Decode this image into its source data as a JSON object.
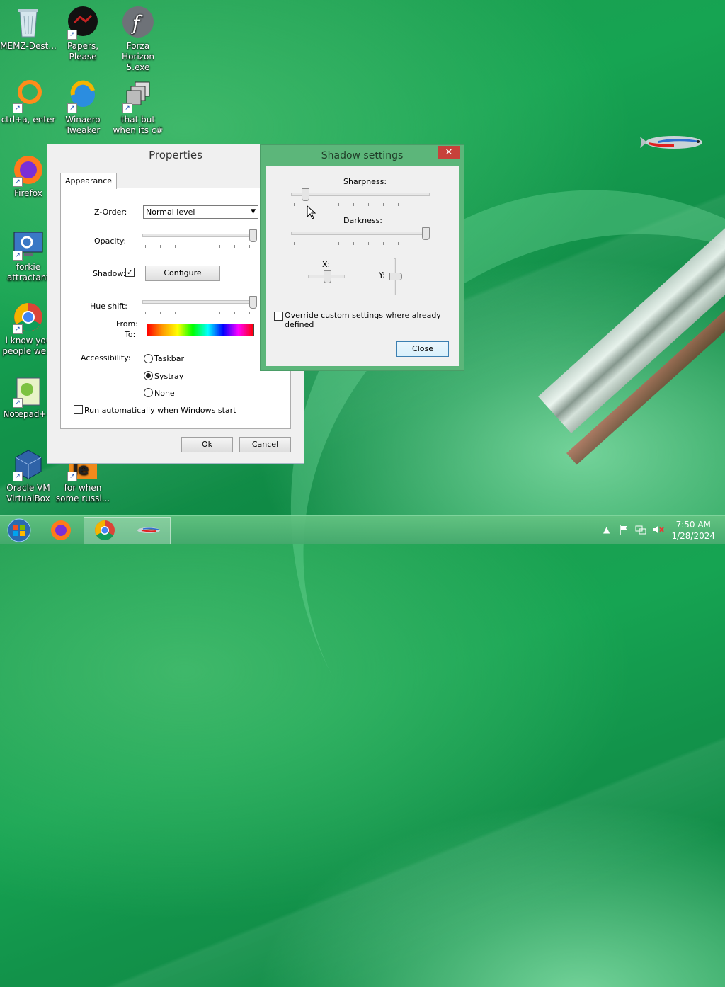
{
  "desktop": {
    "icons": [
      {
        "label": "MEMZ-Dest..."
      },
      {
        "label": "Papers, Please"
      },
      {
        "label": "Forza Horizon 5.exe"
      },
      {
        "label": "ctrl+a, enter"
      },
      {
        "label": "Winaero Tweaker"
      },
      {
        "label": "that but when its c#"
      },
      {
        "label": "Firefox"
      },
      {
        "label": "forkie attractant"
      },
      {
        "label": "i know you people we..."
      },
      {
        "label": "Notepad++"
      },
      {
        "label": "Oracle VM VirtualBox"
      },
      {
        "label": "for when some russi..."
      }
    ]
  },
  "properties": {
    "title": "Properties",
    "tab": "Appearance",
    "zorder_label": "Z-Order:",
    "zorder_value": "Normal level",
    "opacity_label": "Opacity:",
    "opacity_level": 1.0,
    "shadow_label": "Shadow:",
    "shadow_checked": true,
    "configure_label": "Configure",
    "hue_label": "Hue shift:",
    "hue_level": 1.0,
    "from_label": "From:",
    "to_label": "To:",
    "accessibility_label": "Accessibility:",
    "radio_taskbar": "Taskbar",
    "radio_systray": "Systray",
    "radio_none": "None",
    "selected_radio": "Systray",
    "autorun_label": "Run automatically when Windows start",
    "ok_label": "Ok",
    "cancel_label": "Cancel"
  },
  "shadow_settings": {
    "title": "Shadow settings",
    "close_x": "✕",
    "sharpness_label": "Sharpness:",
    "sharpness_level": 0.08,
    "darkness_label": "Darkness:",
    "darkness_level": 1.0,
    "x_label": "X:",
    "y_label": "Y:",
    "override_label": "Override custom settings where already defined",
    "close_label": "Close"
  },
  "taskbar": {
    "time": "7:50 AM",
    "date": "1/28/2024",
    "tray_up": "▲"
  },
  "colors": {
    "accent_green": "#5cb67a",
    "close_red": "#c7413a"
  }
}
